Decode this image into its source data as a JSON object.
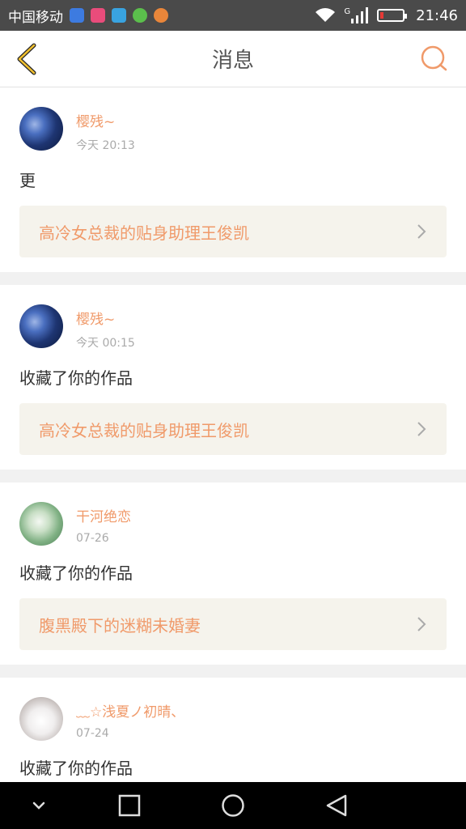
{
  "status_bar": {
    "carrier": "中国移动",
    "network_type": "G",
    "time": "21:46"
  },
  "header": {
    "title": "消息",
    "back_icon": "chevron-left-icon",
    "search_icon": "search-icon"
  },
  "messages": [
    {
      "username": "樱残~",
      "time": "今天 20:13",
      "text": "更",
      "work_title": "高冷女总裁的贴身助理王俊凯",
      "avatar": "blue-flowers"
    },
    {
      "username": "樱残~",
      "time": "今天 00:15",
      "text": "收藏了你的作品",
      "work_title": "高冷女总裁的贴身助理王俊凯",
      "avatar": "blue-flowers"
    },
    {
      "username": "干河绝恋",
      "time": "07-26",
      "text": "收藏了你的作品",
      "work_title": "腹黑殿下的迷糊未婚妻",
      "avatar": "green-figure"
    },
    {
      "username": "﹏☆浅夏ノ初晴、",
      "time": "07-24",
      "text": "收藏了你的作品",
      "work_title": "",
      "avatar": "girl-photo"
    }
  ],
  "colors": {
    "accent": "#f09a6a",
    "back_arrow": "#e7a82a",
    "card_work_bg": "#f5f3ec"
  }
}
